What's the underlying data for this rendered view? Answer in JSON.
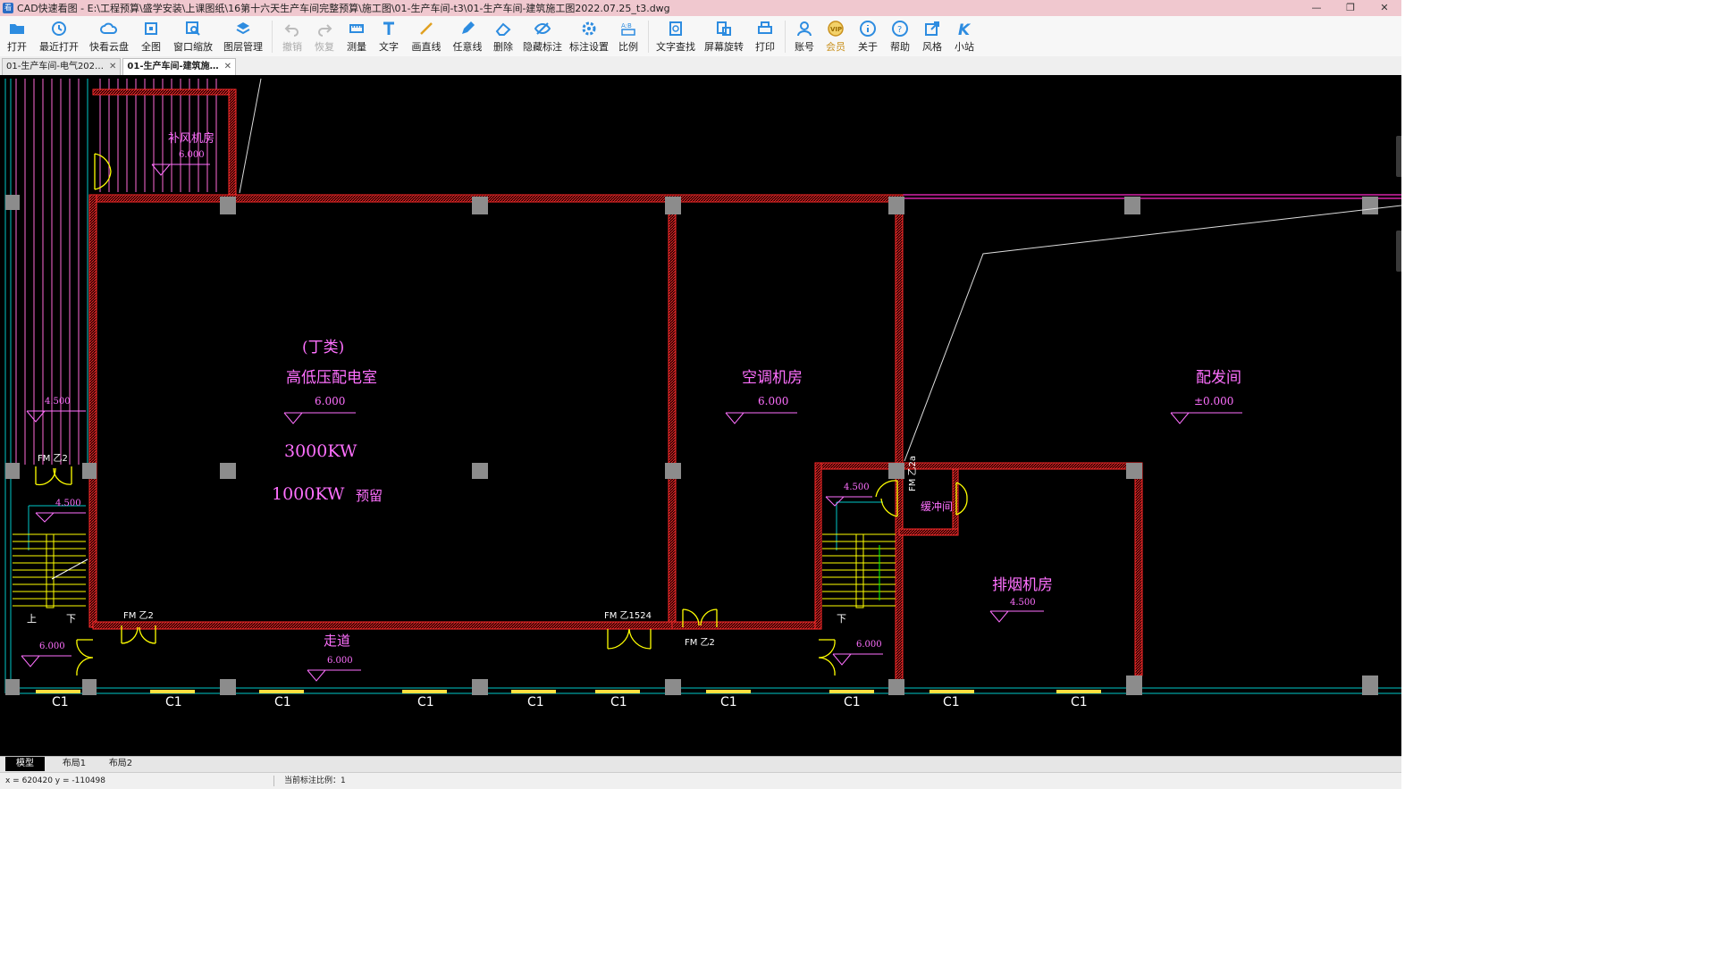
{
  "window": {
    "title": "CAD快速看图 - E:\\工程预算\\盛学安装\\上课图纸\\16第十六天生产车间完整预算\\施工图\\01-生产车间-t3\\01-生产车间-建筑施工图2022.07.25_t3.dwg",
    "app_icon_text": "看"
  },
  "toolbar": {
    "open": "打开",
    "recent": "最近打开",
    "cloud": "快看云盘",
    "fit": "全图",
    "zoom_window": "窗口缩放",
    "layers": "图层管理",
    "undo": "撤销",
    "redo": "恢复",
    "measure": "测量",
    "text": "文字",
    "draw_line": "画直线",
    "freehand": "任意线",
    "erase": "删除",
    "hide_annot": "隐藏标注",
    "annot_settings": "标注设置",
    "scale": "比例",
    "text_search": "文字查找",
    "rotate": "屏幕旋转",
    "print": "打印",
    "account": "账号",
    "vip": "会员",
    "about": "关于",
    "help": "帮助",
    "style": "风格",
    "station": "小站"
  },
  "doc_tabs": [
    {
      "label": "01-生产车间-电气202…",
      "active": false
    },
    {
      "label": "01-生产车间-建筑施…",
      "active": true
    }
  ],
  "drawing": {
    "fan_room": "补风机房",
    "fan_room_elev": "6.000",
    "class_d": "(丁类)",
    "switch_room": "高低压配电室",
    "switch_room_elev": "6.000",
    "power_3000": "3000KW",
    "power_1000": "1000KW",
    "reserved": "预留",
    "ac_room": "空调机房",
    "ac_room_elev": "6.000",
    "distribution_room": "配发间",
    "distribution_elev": "±0.000",
    "smoke_room": "排烟机房",
    "smoke_room_elev": "4.500",
    "buffer_room": "缓冲间",
    "corridor": "走道",
    "corridor_elev": "6.000",
    "left_elev_top": "4.500",
    "left_stair_elev": "4.500",
    "left_bottom_elev": "6.000",
    "right_stair_elev": "4.500",
    "right_bottom_elev": "6.000",
    "stair_up": "上",
    "stair_down": "下",
    "stair_down_right": "下",
    "door_fmz2": "FM 乙2",
    "door_fmz1524": "FM 乙1524",
    "door_fmz2a": "FM 乙2a",
    "window_c1": "C1"
  },
  "layout_tabs": [
    "模型",
    "布局1",
    "布局2"
  ],
  "status": {
    "coord": "x = 620420  y = -110498",
    "scale": "当前标注比例：1"
  },
  "colors": {
    "wall_red": "#ff2a2a",
    "label_magenta": "#ff70ff",
    "door_yellow": "#ffff00",
    "cyan": "#00c8c8",
    "column_gray": "#8c8c8c",
    "canvas_bg": "#000000"
  }
}
